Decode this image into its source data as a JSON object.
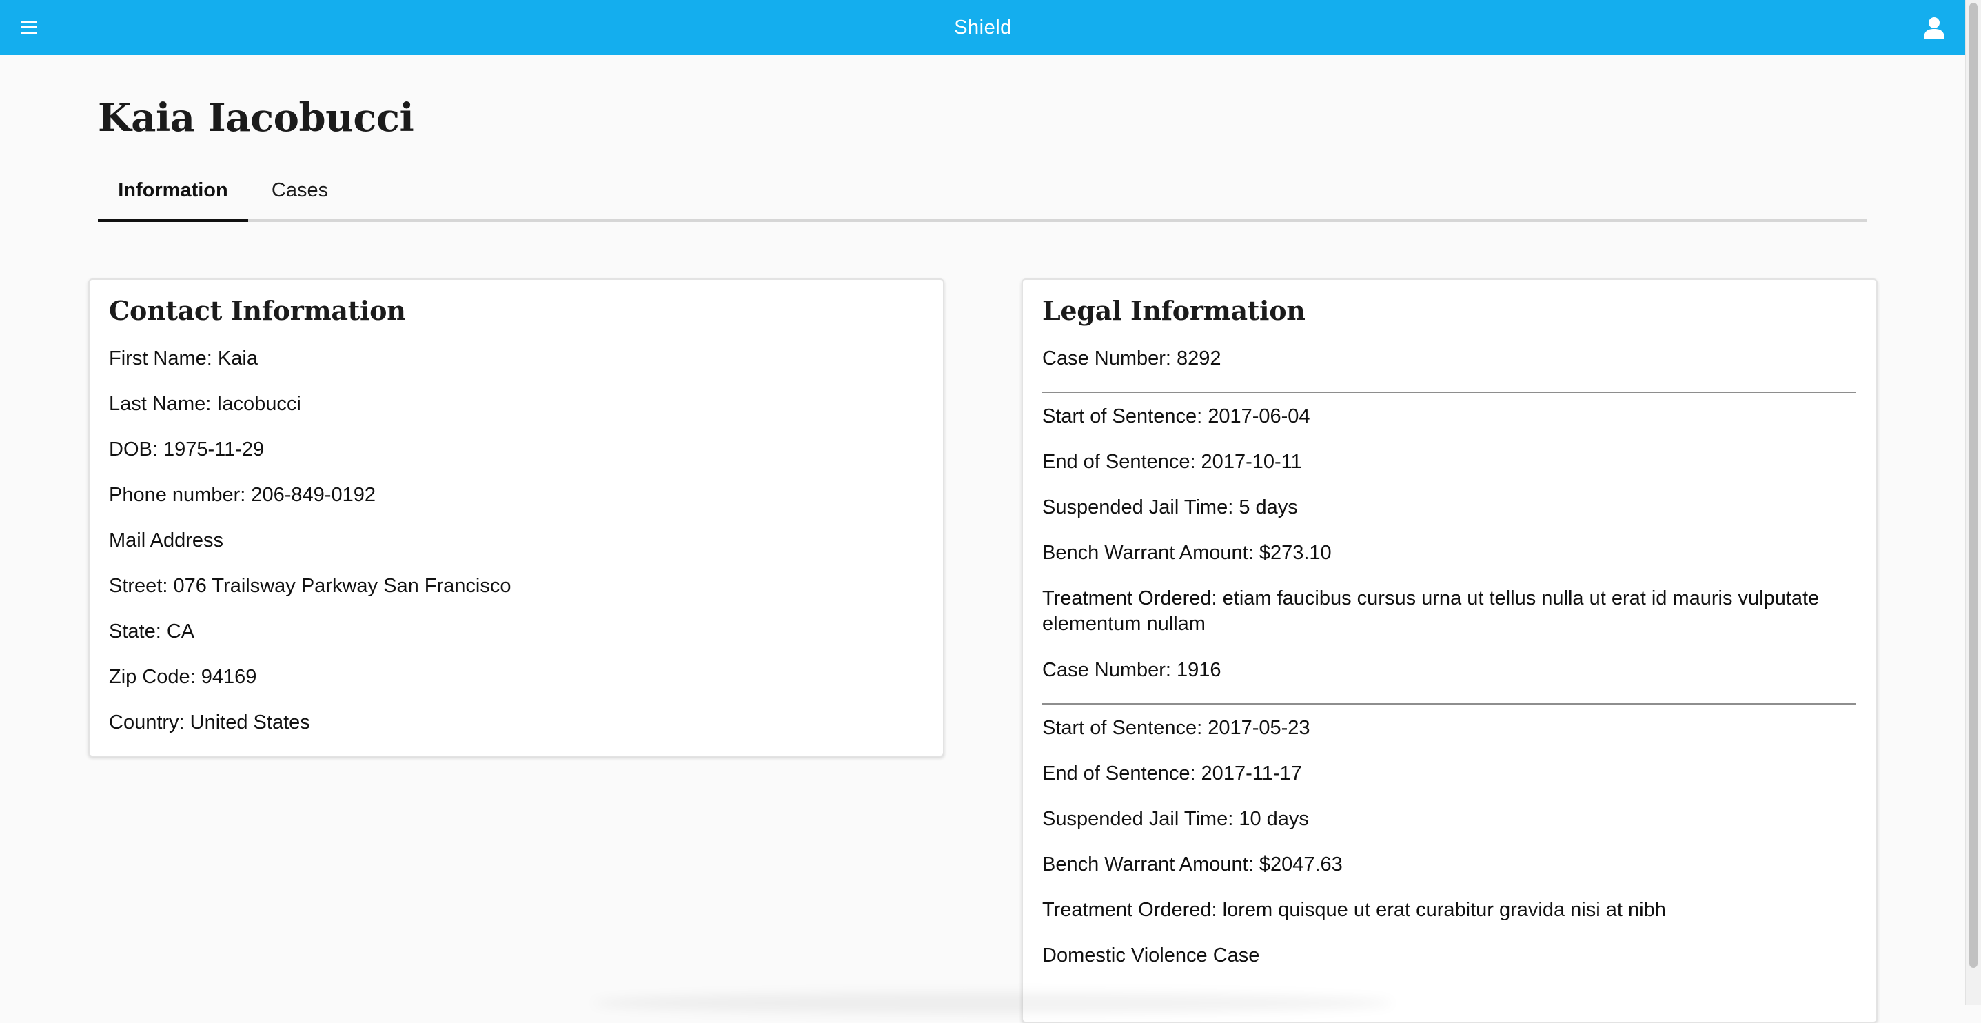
{
  "app": {
    "title": "Shield",
    "header_color": "#14aeee",
    "menu_icon": "menu-icon",
    "user_icon": "user-icon"
  },
  "person": {
    "name": "Kaia Iacobucci"
  },
  "tabs": [
    {
      "label": "Information",
      "active": true
    },
    {
      "label": "Cases",
      "active": false
    }
  ],
  "contact": {
    "heading": "Contact Information",
    "fields": [
      "First Name: Kaia",
      "Last Name: Iacobucci",
      "DOB: 1975-11-29",
      "Phone number: 206-849-0192",
      "Mail Address",
      "Street: 076 Trailsway Parkway San Francisco",
      "State: CA",
      "Zip Code: 94169",
      "Country: United States"
    ]
  },
  "legal": {
    "heading": "Legal Information",
    "cases": [
      {
        "case_number": "Case Number: 8292",
        "start": "Start of Sentence: 2017-06-04",
        "end": "End of Sentence: 2017-10-11",
        "suspended": "Suspended Jail Time: 5 days",
        "bench_warrant": "Bench Warrant Amount: $273.10",
        "treatment": "Treatment Ordered: etiam faucibus cursus urna ut tellus nulla ut erat id mauris vulputate elementum nullam"
      },
      {
        "case_number": "Case Number: 1916",
        "start": "Start of Sentence: 2017-05-23",
        "end": "End of Sentence: 2017-11-17",
        "suspended": "Suspended Jail Time: 10 days",
        "bench_warrant": "Bench Warrant Amount: $2047.63",
        "treatment": "Treatment Ordered: lorem quisque ut erat curabitur gravida nisi at nibh",
        "note": "Domestic Violence Case"
      }
    ]
  }
}
